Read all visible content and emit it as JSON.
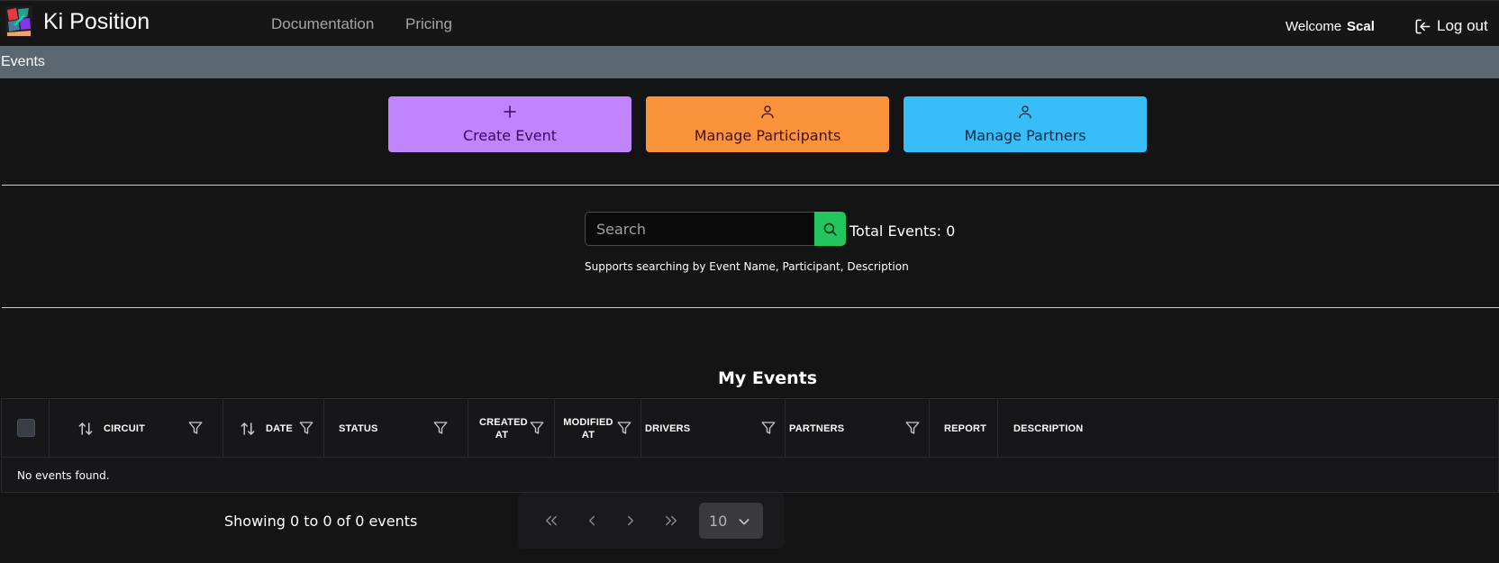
{
  "header": {
    "app_name": "Ki Position",
    "nav": [
      {
        "label": "Documentation"
      },
      {
        "label": "Pricing"
      }
    ],
    "welcome_label": "Welcome",
    "username": "Scal",
    "logout_label": "Log out"
  },
  "breadcrumb": {
    "label": "Events"
  },
  "actions": {
    "create_event": "Create Event",
    "manage_participants": "Manage Participants",
    "manage_partners": "Manage Partners"
  },
  "search": {
    "placeholder": "Search",
    "value": "",
    "total_events": "Total Events: 0",
    "help": "Supports searching by Event Name, Participant, Description"
  },
  "table": {
    "title": "My Events",
    "columns": {
      "circuit": "CIRCUIT",
      "date": "DATE",
      "status": "STATUS",
      "created_at_1": "CREATED",
      "created_at_2": "AT",
      "modified_at_1": "MODIFIED",
      "modified_at_2": "AT",
      "drivers": "DRIVERS",
      "partners": "PARTNERS",
      "report": "REPORT",
      "description": "DESCRIPTION"
    },
    "empty_message": "No events found."
  },
  "pagination": {
    "summary": "Showing 0 to 0 of 0 events",
    "page_size": "10"
  },
  "colors": {
    "create": "#c084fc",
    "participants": "#fb923c",
    "partners": "#38bdf8",
    "search_button": "#22c55e",
    "breadcrumb_bar": "#5b6770"
  },
  "icons": [
    "app-logo-icon",
    "logout-icon",
    "plus-icon",
    "user-icon",
    "search-icon",
    "sort-icon",
    "filter-icon",
    "first-page-icon",
    "prev-page-icon",
    "next-page-icon",
    "last-page-icon",
    "chevron-down-icon"
  ]
}
